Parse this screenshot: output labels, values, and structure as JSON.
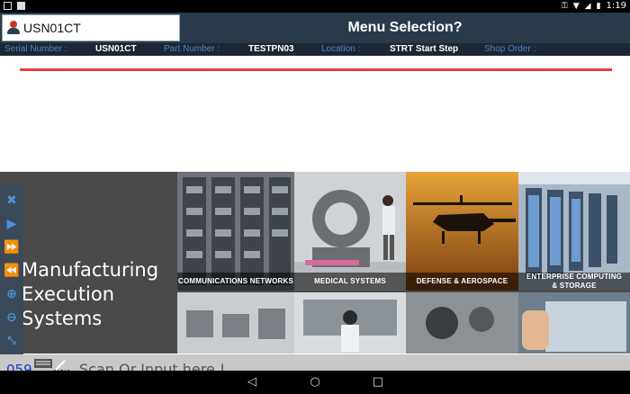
{
  "statusbar": {
    "time": "1:19"
  },
  "header": {
    "serial_value": "USN01CT",
    "title": "Menu Selection?"
  },
  "info": {
    "serial_label": "Serial Number :",
    "serial_value": "USN01CT",
    "part_label": "Part Number :",
    "part_value": "TESTPN03",
    "location_label": "Location :",
    "location_value": "STRT Start Step",
    "shop_label": "Shop Order :",
    "shop_value": ""
  },
  "banner": {
    "line1": "Manufacturing",
    "line2": "Execution",
    "line3": "Systems",
    "tiles": {
      "comm": "COMMUNICATIONS NETWORKS",
      "medical": "MEDICAL SYSTEMS",
      "defense": "DEFENSE & AEROSPACE",
      "enterprise1": "ENTERPRISE COMPUTING",
      "enterprise2": "& STORAGE"
    }
  },
  "inputbar": {
    "counter": "059",
    "placeholder": "Scan Or Input here !"
  },
  "colors": {
    "accent_red": "#e8413a",
    "header_bg": "#2b3a4a",
    "counter_blue": "#1a3ad0"
  }
}
